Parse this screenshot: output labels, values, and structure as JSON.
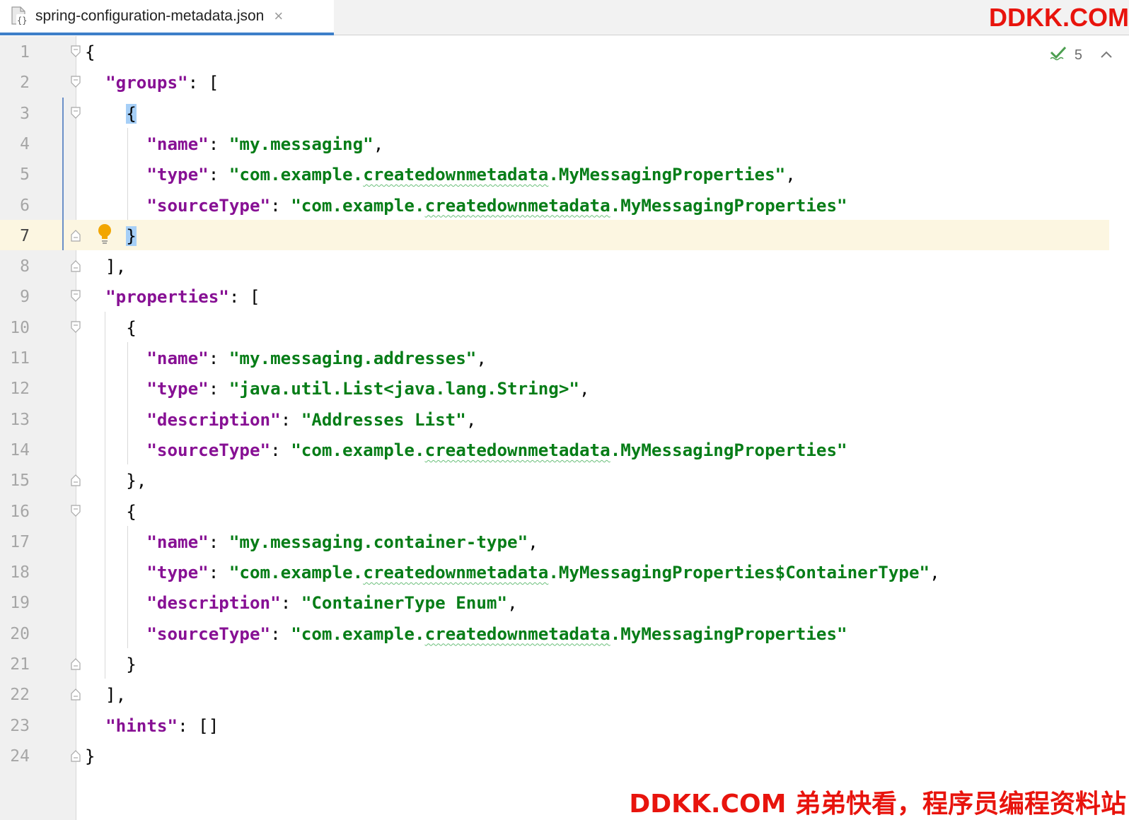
{
  "tab": {
    "filename": "spring-configuration-metadata.json",
    "icon": "json-file-icon",
    "close_icon": "close-icon"
  },
  "watermark_top": "DDKK.COM",
  "watermark_bottom": "DDKK.COM 弟弟快看，程序员编程资料站",
  "inspection": {
    "count": "5",
    "icon": "check-icon",
    "nav_icon": "chevron-up-icon"
  },
  "colors": {
    "key": "#871094",
    "string": "#067d17",
    "current_line": "#fcf6e1",
    "brace_highlight": "#a6cff7",
    "tab_underline": "#3d7fc9",
    "watermark": "#e8140d"
  },
  "lines": [
    {
      "n": "1",
      "tokens": [
        {
          "t": "p",
          "v": "{"
        }
      ]
    },
    {
      "n": "2",
      "tokens": [
        {
          "t": "p",
          "v": "  "
        },
        {
          "t": "k",
          "v": "\"groups\""
        },
        {
          "t": "p",
          "v": ": ["
        }
      ]
    },
    {
      "n": "3",
      "tokens": [
        {
          "t": "p",
          "v": "    "
        },
        {
          "t": "hl",
          "v": "{"
        }
      ]
    },
    {
      "n": "4",
      "tokens": [
        {
          "t": "p",
          "v": "      "
        },
        {
          "t": "k",
          "v": "\"name\""
        },
        {
          "t": "p",
          "v": ": "
        },
        {
          "t": "s",
          "v": "\"my.messaging\""
        },
        {
          "t": "p",
          "v": ","
        }
      ]
    },
    {
      "n": "5",
      "tokens": [
        {
          "t": "p",
          "v": "      "
        },
        {
          "t": "k",
          "v": "\"type\""
        },
        {
          "t": "p",
          "v": ": "
        },
        {
          "t": "s",
          "v": "\"com.example."
        },
        {
          "t": "sq",
          "v": "createdownmetadata"
        },
        {
          "t": "s",
          "v": ".MyMessagingProperties\""
        },
        {
          "t": "p",
          "v": ","
        }
      ]
    },
    {
      "n": "6",
      "tokens": [
        {
          "t": "p",
          "v": "      "
        },
        {
          "t": "k",
          "v": "\"sourceType\""
        },
        {
          "t": "p",
          "v": ": "
        },
        {
          "t": "s",
          "v": "\"com.example."
        },
        {
          "t": "sq",
          "v": "createdownmetadata"
        },
        {
          "t": "s",
          "v": ".MyMessagingProperties\""
        }
      ]
    },
    {
      "n": "7",
      "tokens": [
        {
          "t": "p",
          "v": "    "
        },
        {
          "t": "hl",
          "v": "}"
        }
      ],
      "current": true
    },
    {
      "n": "8",
      "tokens": [
        {
          "t": "p",
          "v": "  ],"
        }
      ]
    },
    {
      "n": "9",
      "tokens": [
        {
          "t": "p",
          "v": "  "
        },
        {
          "t": "k",
          "v": "\"properties\""
        },
        {
          "t": "p",
          "v": ": ["
        }
      ]
    },
    {
      "n": "10",
      "tokens": [
        {
          "t": "p",
          "v": "    {"
        }
      ]
    },
    {
      "n": "11",
      "tokens": [
        {
          "t": "p",
          "v": "      "
        },
        {
          "t": "k",
          "v": "\"name\""
        },
        {
          "t": "p",
          "v": ": "
        },
        {
          "t": "s",
          "v": "\"my.messaging.addresses\""
        },
        {
          "t": "p",
          "v": ","
        }
      ]
    },
    {
      "n": "12",
      "tokens": [
        {
          "t": "p",
          "v": "      "
        },
        {
          "t": "k",
          "v": "\"type\""
        },
        {
          "t": "p",
          "v": ": "
        },
        {
          "t": "s",
          "v": "\"java.util.List<java.lang.String>\""
        },
        {
          "t": "p",
          "v": ","
        }
      ]
    },
    {
      "n": "13",
      "tokens": [
        {
          "t": "p",
          "v": "      "
        },
        {
          "t": "k",
          "v": "\"description\""
        },
        {
          "t": "p",
          "v": ": "
        },
        {
          "t": "s",
          "v": "\"Addresses List\""
        },
        {
          "t": "p",
          "v": ","
        }
      ]
    },
    {
      "n": "14",
      "tokens": [
        {
          "t": "p",
          "v": "      "
        },
        {
          "t": "k",
          "v": "\"sourceType\""
        },
        {
          "t": "p",
          "v": ": "
        },
        {
          "t": "s",
          "v": "\"com.example."
        },
        {
          "t": "sq",
          "v": "createdownmetadata"
        },
        {
          "t": "s",
          "v": ".MyMessagingProperties\""
        }
      ]
    },
    {
      "n": "15",
      "tokens": [
        {
          "t": "p",
          "v": "    },"
        }
      ]
    },
    {
      "n": "16",
      "tokens": [
        {
          "t": "p",
          "v": "    {"
        }
      ]
    },
    {
      "n": "17",
      "tokens": [
        {
          "t": "p",
          "v": "      "
        },
        {
          "t": "k",
          "v": "\"name\""
        },
        {
          "t": "p",
          "v": ": "
        },
        {
          "t": "s",
          "v": "\"my.messaging.container-type\""
        },
        {
          "t": "p",
          "v": ","
        }
      ]
    },
    {
      "n": "18",
      "tokens": [
        {
          "t": "p",
          "v": "      "
        },
        {
          "t": "k",
          "v": "\"type\""
        },
        {
          "t": "p",
          "v": ": "
        },
        {
          "t": "s",
          "v": "\"com.example."
        },
        {
          "t": "sq",
          "v": "createdownmetadata"
        },
        {
          "t": "s",
          "v": ".MyMessagingProperties$ContainerType\""
        },
        {
          "t": "p",
          "v": ","
        }
      ]
    },
    {
      "n": "19",
      "tokens": [
        {
          "t": "p",
          "v": "      "
        },
        {
          "t": "k",
          "v": "\"description\""
        },
        {
          "t": "p",
          "v": ": "
        },
        {
          "t": "s",
          "v": "\"ContainerType Enum\""
        },
        {
          "t": "p",
          "v": ","
        }
      ]
    },
    {
      "n": "20",
      "tokens": [
        {
          "t": "p",
          "v": "      "
        },
        {
          "t": "k",
          "v": "\"sourceType\""
        },
        {
          "t": "p",
          "v": ": "
        },
        {
          "t": "s",
          "v": "\"com.example."
        },
        {
          "t": "sq",
          "v": "createdownmetadata"
        },
        {
          "t": "s",
          "v": ".MyMessagingProperties\""
        }
      ]
    },
    {
      "n": "21",
      "tokens": [
        {
          "t": "p",
          "v": "    }"
        }
      ]
    },
    {
      "n": "22",
      "tokens": [
        {
          "t": "p",
          "v": "  ],"
        }
      ]
    },
    {
      "n": "23",
      "tokens": [
        {
          "t": "p",
          "v": "  "
        },
        {
          "t": "k",
          "v": "\"hints\""
        },
        {
          "t": "p",
          "v": ": []"
        }
      ]
    },
    {
      "n": "24",
      "tokens": [
        {
          "t": "p",
          "v": "}"
        }
      ]
    }
  ]
}
